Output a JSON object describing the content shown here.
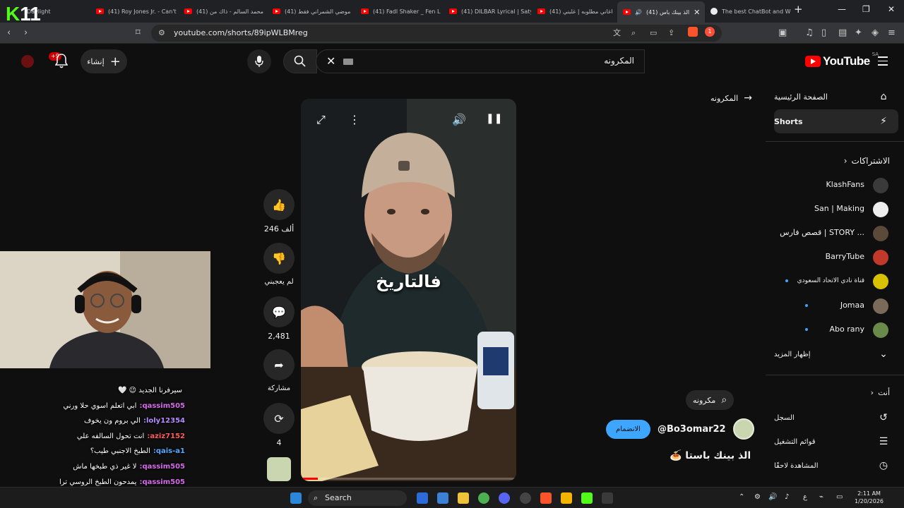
{
  "browser": {
    "tabs": [
      {
        "title": "Daylight",
        "favicon": "kick-icon"
      },
      {
        "title": "(41) Roy Jones Jr. - Can't",
        "favicon": "youtube-icon"
      },
      {
        "title": "(41) محمد السالم - ذاك من",
        "favicon": "youtube-icon"
      },
      {
        "title": "(41) موضي الشمراني فقط",
        "favicon": "youtube-icon"
      },
      {
        "title": "(41) Fadl Shaker _ Fen L",
        "favicon": "youtube-icon"
      },
      {
        "title": "(41) DILBAR Lyrical | Saty",
        "favicon": "youtube-icon"
      },
      {
        "title": "(41) اغاني مطلوبه | غلبني",
        "favicon": "youtube-icon"
      },
      {
        "title": "(41) الذ بينك باس",
        "favicon": "youtube-icon"
      },
      {
        "title": "The best ChatBot and W",
        "favicon": "chatgpt-icon"
      }
    ],
    "url": "youtube.com/shorts/89ipWLBMreg",
    "extension_badge": "1"
  },
  "stream_overlay": {
    "logo_k": "K",
    "logo_number": "11",
    "chat": [
      {
        "user": "",
        "message": "سيرفرنا الجديد 😉 🤍",
        "color": "#ffffff"
      },
      {
        "user": "qassim505:",
        "message": "ابي اتعلم اسوي حلا ورني",
        "color": "#d36be8"
      },
      {
        "user": "loly12354:",
        "message": "الي بروم ون يخوف",
        "color": "#b48cff"
      },
      {
        "user": "aziz7152:",
        "message": "انت تحول السالفه علي",
        "color": "#ff5b5b"
      },
      {
        "user": "qais-a1:",
        "message": "الطبخ الاجنبي طيب؟",
        "color": "#5aa8ff"
      },
      {
        "user": "qassim505:",
        "message": "لا غير ذي طبخها ماش",
        "color": "#d36be8"
      },
      {
        "user": "qassim505:",
        "message": "يمدحون الطبخ الروسي ترا",
        "color": "#d36be8"
      },
      {
        "user": "qais-a1:",
        "message": "لا تحط مصرية تكفى",
        "color": "#5aa8ff"
      }
    ]
  },
  "youtube": {
    "logo": "YouTube",
    "country_code": "SA",
    "search": {
      "query": "المكرونه"
    },
    "create_label": "إنشاء",
    "notification_count": "+9",
    "back_label": "المكرونه",
    "sidebar": {
      "main": [
        {
          "label": "الصفحة الرئيسية",
          "icon": "home-icon"
        },
        {
          "label": "Shorts",
          "icon": "shorts-icon"
        }
      ],
      "subscriptions_header": "الاشتراكات",
      "channels": [
        {
          "name": "KlashFans",
          "color": "#3a3a3a",
          "new": false
        },
        {
          "name": "San | Making",
          "color": "#eeeeee",
          "new": false
        },
        {
          "name": "قصص فارس | STORY ...",
          "color": "#5b4a3a",
          "new": false
        },
        {
          "name": "BarryTube",
          "color": "#c0392b",
          "new": false
        },
        {
          "name": "قناة نادي الاتحاد السعودي",
          "color": "#d8c200",
          "new": true
        },
        {
          "name": "Jomaa",
          "color": "#7a6a5a",
          "new": true
        },
        {
          "name": "Abo rany",
          "color": "#6a8a4a",
          "new": true
        }
      ],
      "show_more": "إظهار المزيد",
      "you_header": "أنت",
      "you_items": [
        {
          "label": "السجل",
          "icon": "history-icon"
        },
        {
          "label": "قوائم التشغيل",
          "icon": "playlists-icon"
        },
        {
          "label": "المشاهدة لاحقًا",
          "icon": "watch-later-icon"
        }
      ]
    },
    "short": {
      "caption": "فالتاريخ",
      "likes": "246 ألف",
      "dislike_label": "لم يعجبني",
      "comments": "2,481",
      "share_label": "مشاركة",
      "remix_count": "4",
      "search_chip": "مكرونه",
      "channel_handle": "@Bo3omar22",
      "join_label": "الانضمام",
      "title": "الذ بينك باستا 🍝",
      "progress": 0.08
    }
  },
  "taskbar": {
    "search_label": "Search",
    "time": "2:11 AM",
    "date": "1/20/2026",
    "lang": "ع"
  }
}
